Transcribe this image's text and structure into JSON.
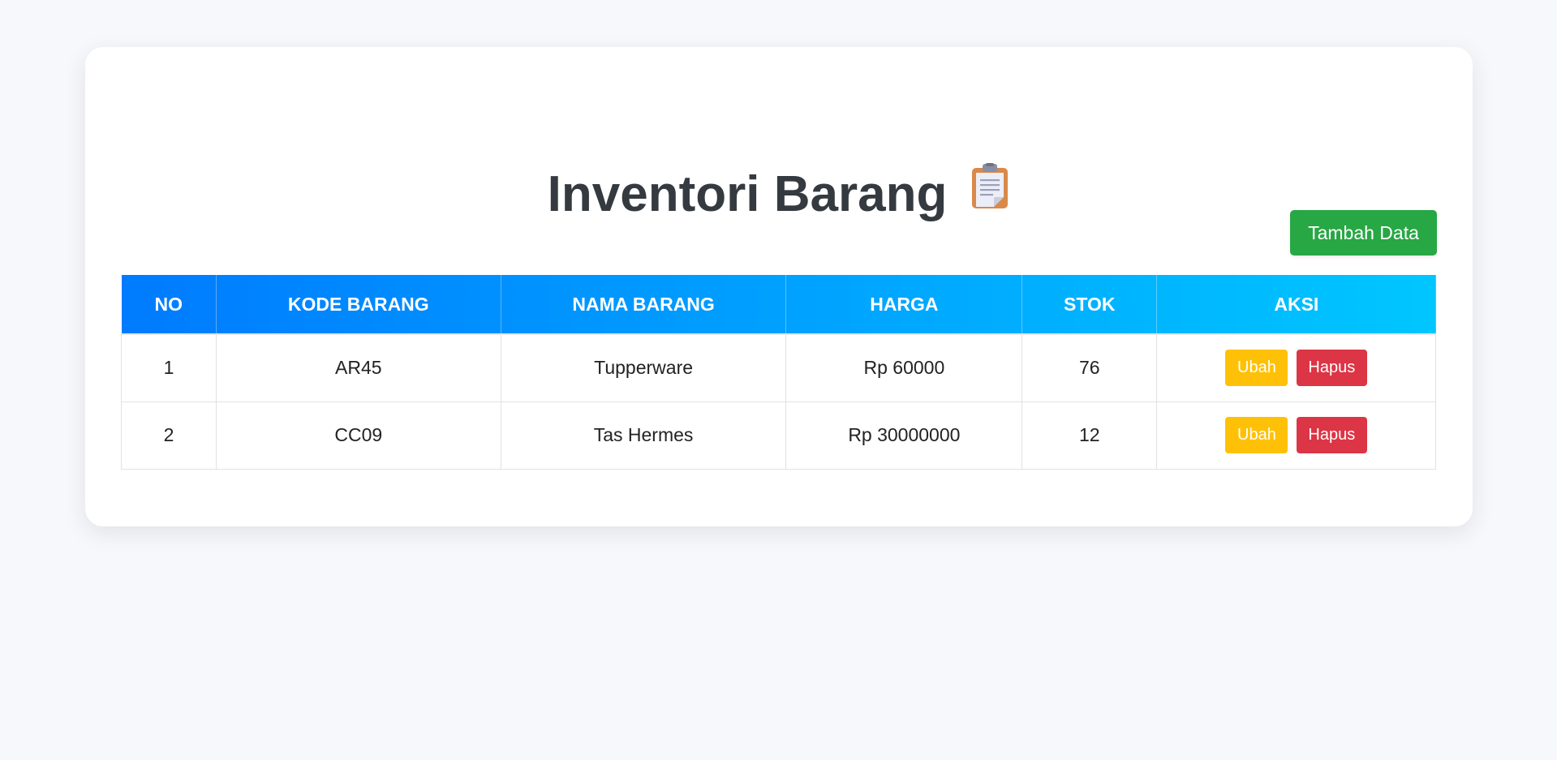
{
  "page": {
    "title": "Inventori Barang",
    "title_icon": "clipboard-icon"
  },
  "toolbar": {
    "add_label": "Tambah Data"
  },
  "table": {
    "headers": [
      "NO",
      "KODE BARANG",
      "NAMA BARANG",
      "HARGA",
      "STOK",
      "AKSI"
    ],
    "rows": [
      {
        "no": "1",
        "kode": "AR45",
        "nama": "Tupperware",
        "harga": "Rp 60000",
        "stok": "76",
        "edit_label": "Ubah",
        "delete_label": "Hapus"
      },
      {
        "no": "2",
        "kode": "CC09",
        "nama": "Tas Hermes",
        "harga": "Rp 30000000",
        "stok": "12",
        "edit_label": "Ubah",
        "delete_label": "Hapus"
      }
    ]
  },
  "colors": {
    "page_bg": "#f7f8fb",
    "header_gradient_start": "#007bff",
    "header_gradient_end": "#00c6ff",
    "add_button": "#28a745",
    "edit_button": "#ffc107",
    "delete_button": "#dc3545",
    "title_text": "#343a40"
  }
}
